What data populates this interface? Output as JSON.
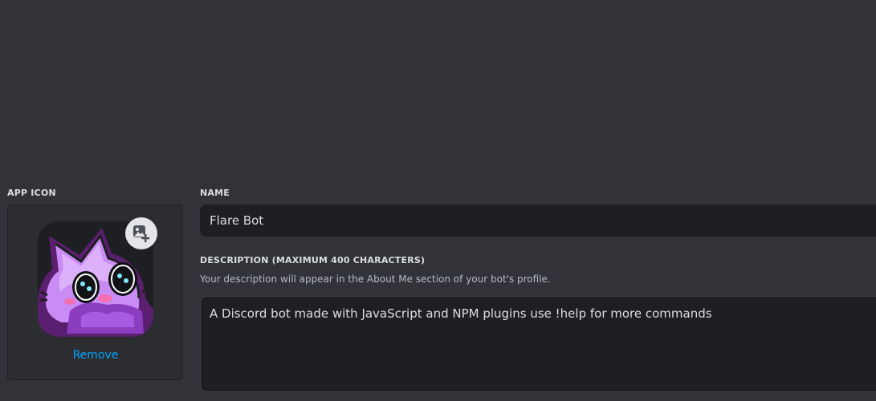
{
  "app_icon": {
    "label": "APP ICON",
    "remove_label": "Remove"
  },
  "name": {
    "label": "NAME",
    "value": "Flare Bot"
  },
  "description": {
    "label": "DESCRIPTION (MAXIMUM 400 CHARACTERS)",
    "help": "Your description will appear in the About Me section of your bot's profile.",
    "value": "A Discord bot made with JavaScript and NPM plugins use !help for more commands"
  },
  "colors": {
    "background": "#313338",
    "input_bg": "#1e1f22",
    "link": "#00a8fc",
    "avatar_purple": "#c98cf5"
  },
  "icons": {
    "upload": "image-add-icon",
    "avatar": "purple-cat-avatar"
  }
}
